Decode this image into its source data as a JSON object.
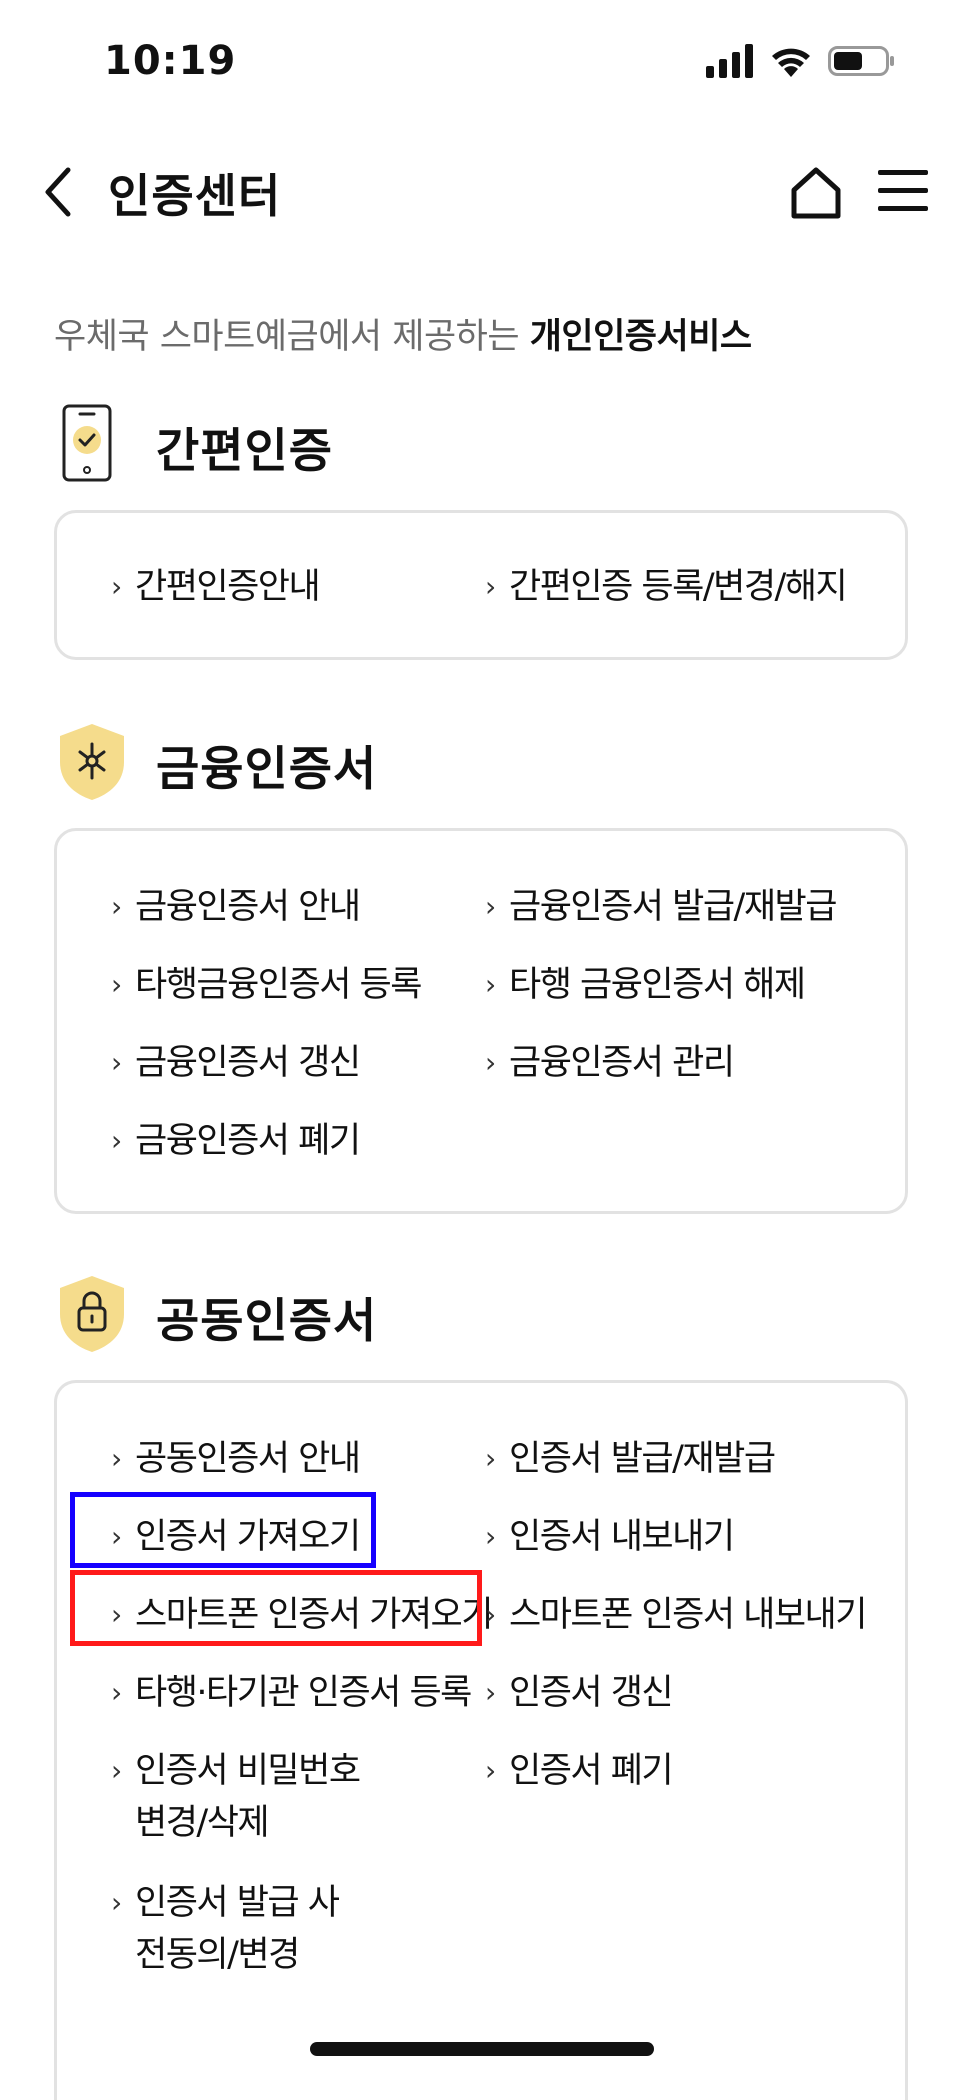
{
  "status_bar": {
    "time": "10:19",
    "battery_level": 0.55
  },
  "header": {
    "title": "인증센터"
  },
  "intro": {
    "text": "우체국 스마트예금에서 제공하는 ",
    "bold": "개인인증서비스"
  },
  "sections": [
    {
      "title": "간편인증",
      "links": [
        "간편인증안내",
        "간편인증 등록/변경/해지"
      ]
    },
    {
      "title": "금융인증서",
      "links": [
        "금융인증서 안내",
        "금융인증서 발급/재발급",
        "타행금융인증서 등록",
        "타행 금융인증서 해제",
        "금융인증서 갱신",
        "금융인증서 관리",
        "금융인증서 폐기"
      ]
    },
    {
      "title": "공동인증서",
      "links": [
        "공동인증서 안내",
        "인증서 발급/재발급",
        "인증서 가져오기",
        "인증서 내보내기",
        "스마트폰 인증서 가져오기",
        "스마트폰 인증서 내보내기",
        "타행·타기관 인증서 등록",
        "인증서 갱신",
        "인증서 비밀번호 변경/삭제",
        "인증서 폐기",
        "인증서 발급 사전동의/변경"
      ]
    }
  ],
  "highlight_colors": {
    "blue": "#1500ff",
    "red": "#ff1a1a"
  },
  "accent_color": "#f5dc8c"
}
